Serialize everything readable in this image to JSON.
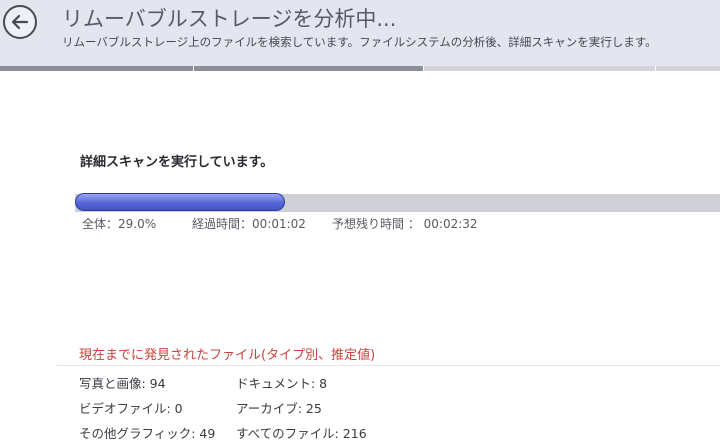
{
  "header": {
    "title": "リムーバブルストレージを分析中...",
    "subtitle": "リムーバブルストレージ上のファイルを検索しています。ファイルシステムの分析後、詳細スキャンを実行します。",
    "back_icon": "arrow-left-icon"
  },
  "scan": {
    "heading": "詳細スキャンを実行しています。",
    "progress_fraction": 0.29,
    "overall": "全体：29.0%",
    "elapsed": "経過時間：00:01:02",
    "remaining": "予想残り時間 ： 00:02:32"
  },
  "found": {
    "heading": "現在までに発見されたファイル(タイプ別、推定値)",
    "photos": "写真と画像: 94",
    "documents": "ドキュメント: 8",
    "videos": "ビデオファイル: 0",
    "archives": "アーカイブ: 25",
    "other_graphics": "その他グラフィック: 49",
    "all_files": "すべてのファイル: 216"
  },
  "colors": {
    "accent_progress": "#4a5bd0",
    "found_heading": "#c8433c",
    "header_bg": "#e4e5ee"
  }
}
